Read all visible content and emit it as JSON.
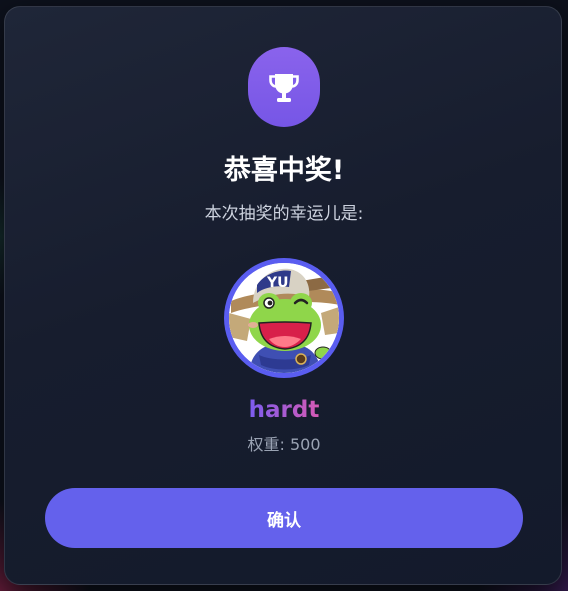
{
  "dialog": {
    "title": "恭喜中奖!",
    "subtitle": "本次抽奖的幸运儿是:",
    "winner": {
      "name": "hardt",
      "weight_text": "权重: 500"
    },
    "confirm_label": "确认"
  },
  "icons": {
    "badge": "trophy-icon",
    "avatar": "cartoon-frog-avatar"
  },
  "colors": {
    "accent": "#6461ec",
    "badge": "#8060ea",
    "avatar_ring": "#5a5df0",
    "winner_name_gradient": [
      "#7b5cf0",
      "#d65ab4"
    ]
  }
}
